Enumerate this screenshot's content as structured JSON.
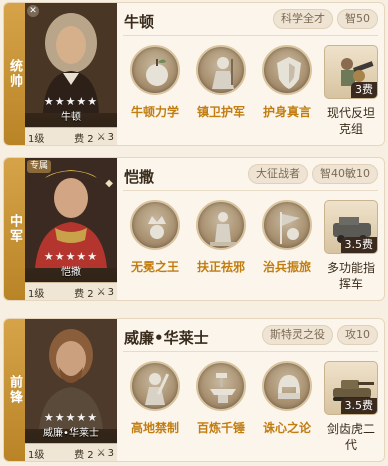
{
  "cards": [
    {
      "role": "统帅",
      "name": "牛顿",
      "portrait_label": "牛顿",
      "stars": "★★★★★",
      "level": "1级",
      "cost": "费 2",
      "sword": "3",
      "tags": [
        "科学全才",
        "智50"
      ],
      "skills": [
        "牛顿力学",
        "镇卫护军",
        "护身真言"
      ],
      "gear": {
        "name": "现代反坦克组",
        "cost": "3费"
      }
    },
    {
      "role": "中军",
      "name": "恺撒",
      "corner_tag": "专属",
      "portrait_label": "恺撒",
      "stars": "★★★★★",
      "level": "1级",
      "cost": "费 2",
      "sword": "3",
      "tags": [
        "大征战者",
        "智40敏10"
      ],
      "skills": [
        "无冕之王",
        "扶正祛邪",
        "治兵振旅"
      ],
      "gear": {
        "name": "多功能指挥车",
        "cost": "3.5费"
      }
    },
    {
      "role": "前锋",
      "name": "威廉•华莱士",
      "portrait_label": "威廉•华莱士",
      "stars": "★★★★★",
      "level": "1级",
      "cost": "费 2",
      "sword": "3",
      "tags": [
        "斯特灵之役",
        "攻10"
      ],
      "skills": [
        "高地禁制",
        "百炼千锤",
        "诛心之论"
      ],
      "gear": {
        "name": "剑齿虎二代",
        "cost": "3.5费"
      }
    }
  ]
}
